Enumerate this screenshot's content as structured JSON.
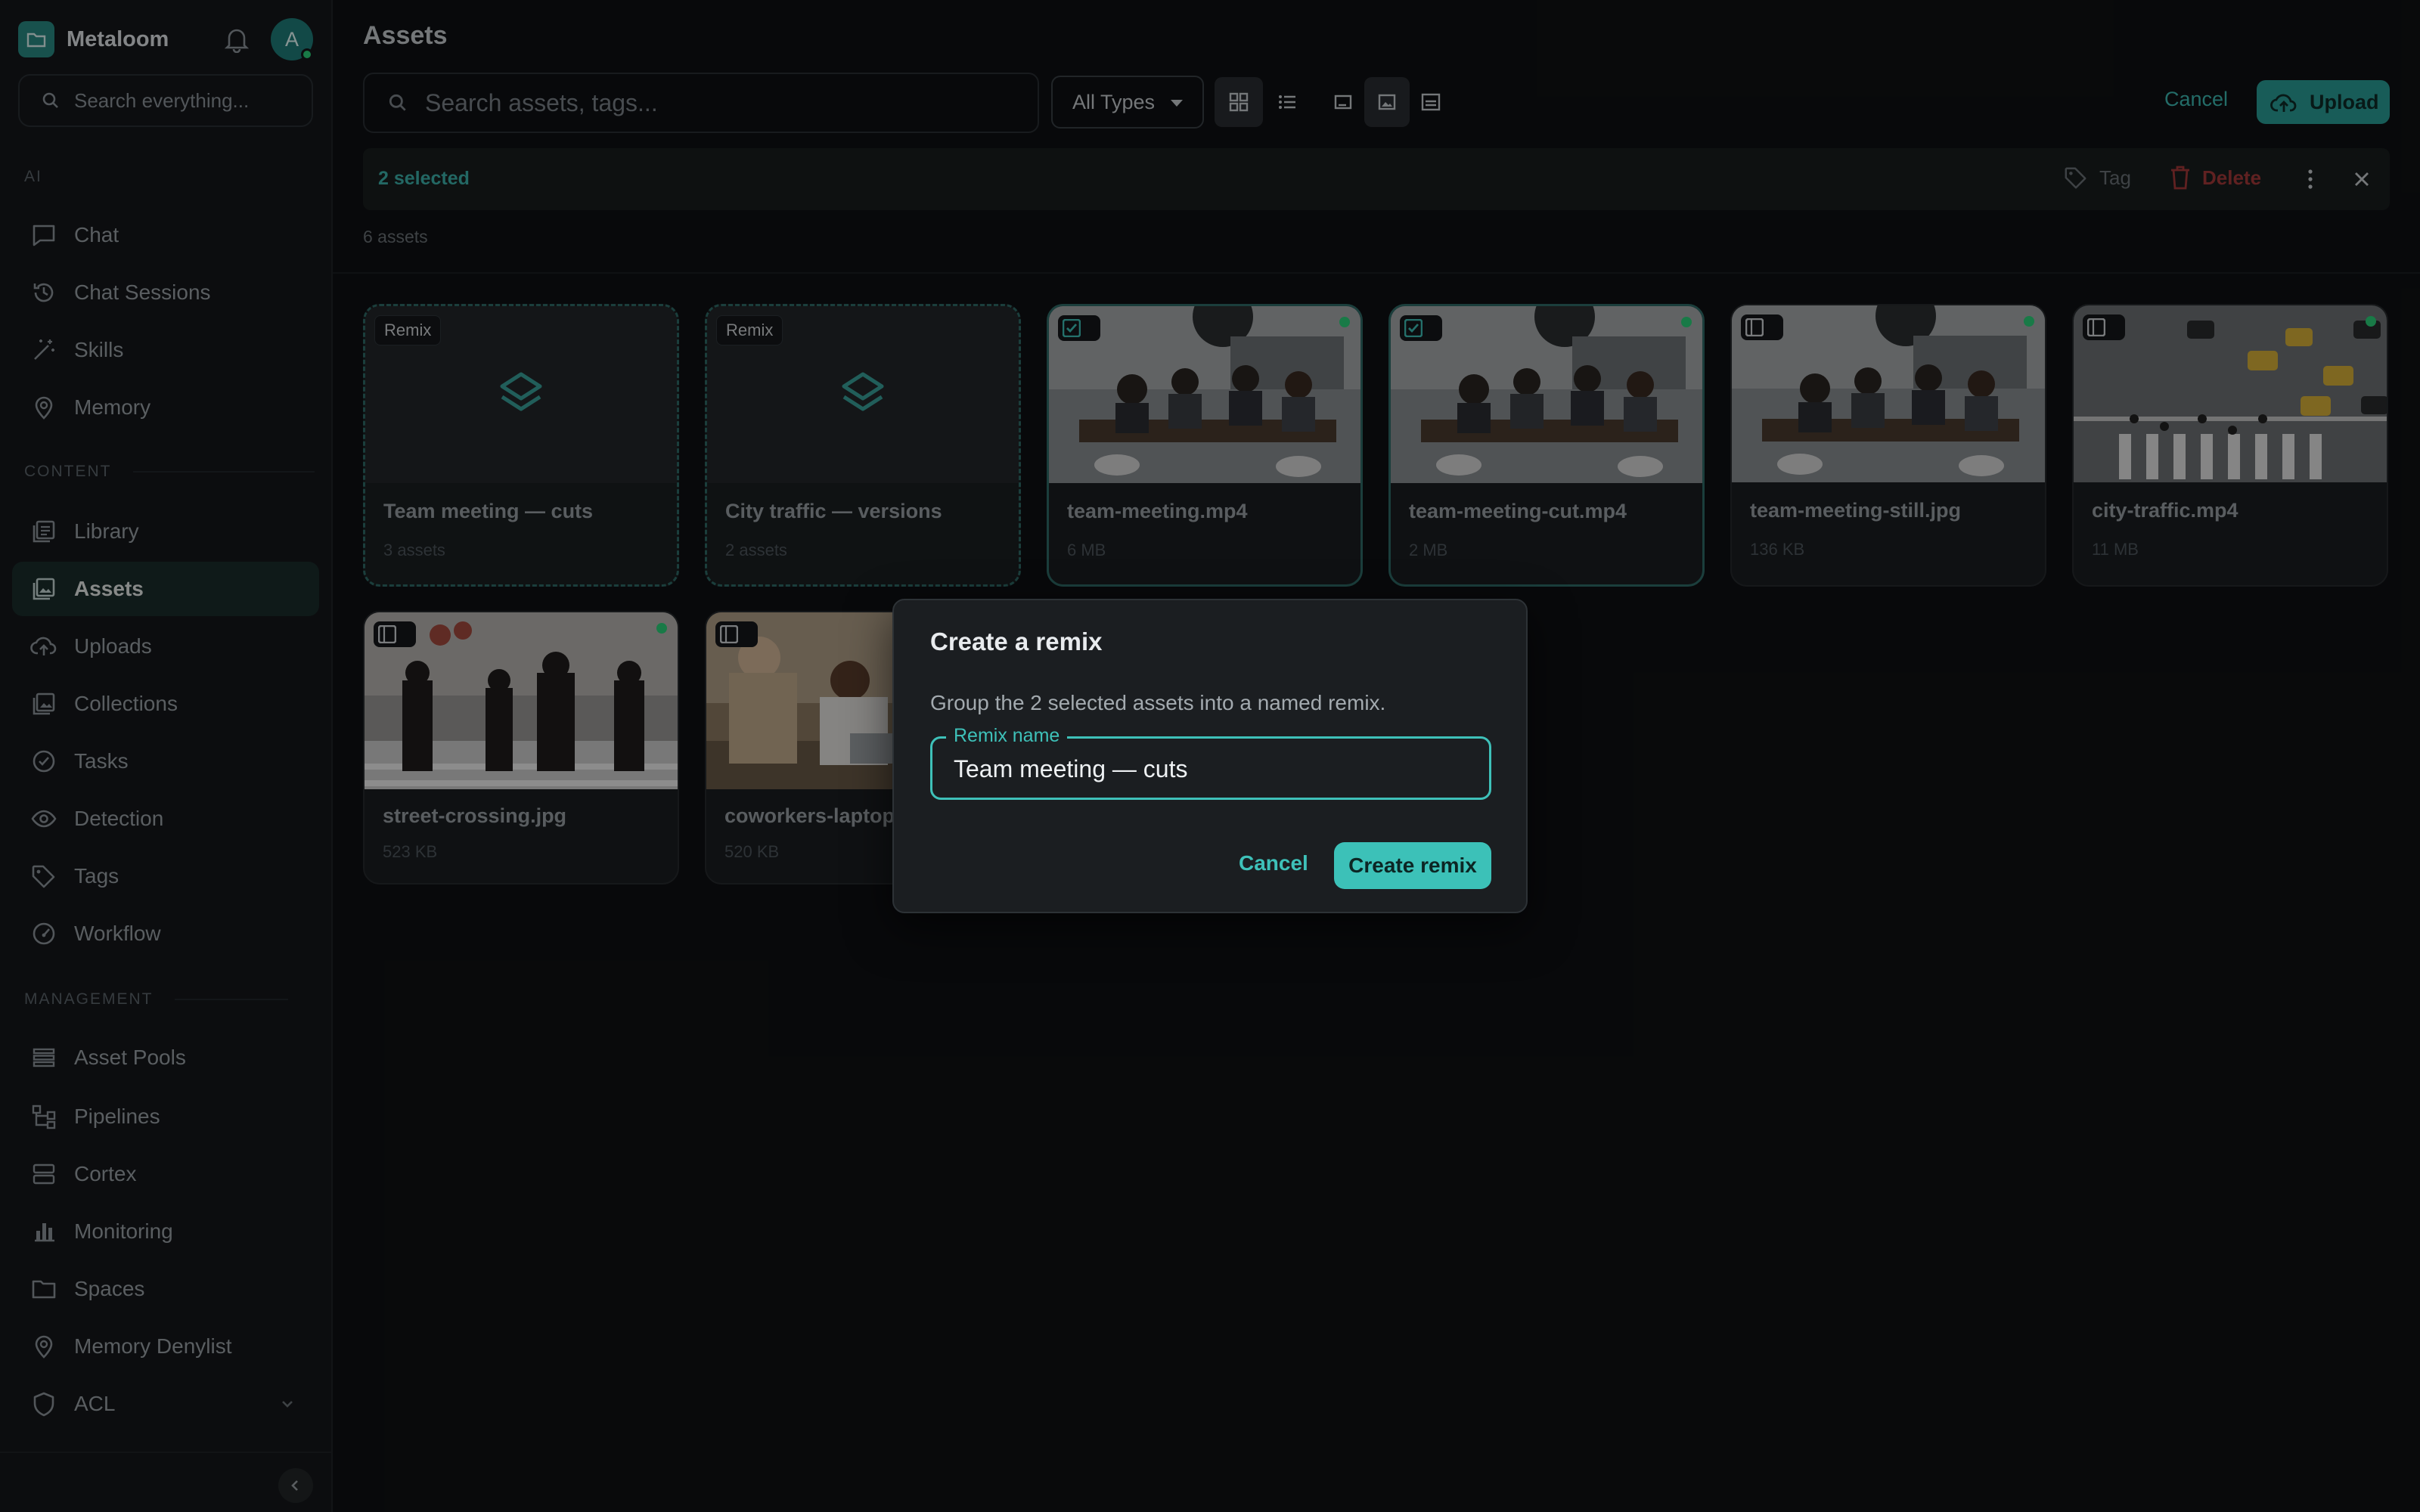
{
  "app": {
    "name": "Metaloom",
    "avatar_letter": "A",
    "search_placeholder": "Search everything..."
  },
  "sidebar": {
    "sections": {
      "ai": "AI",
      "content": "CONTENT",
      "management": "MANAGEMENT"
    },
    "items": [
      {
        "label": "Chat",
        "icon": "chat-icon"
      },
      {
        "label": "Chat Sessions",
        "icon": "history-icon"
      },
      {
        "label": "Skills",
        "icon": "magic-wand-icon"
      },
      {
        "label": "Memory",
        "icon": "memory-pin-icon"
      },
      {
        "label": "Library",
        "icon": "library-icon"
      },
      {
        "label": "Assets",
        "icon": "assets-icon",
        "active": true
      },
      {
        "label": "Uploads",
        "icon": "cloud-upload-icon"
      },
      {
        "label": "Collections",
        "icon": "collections-icon"
      },
      {
        "label": "Tasks",
        "icon": "check-circle-icon"
      },
      {
        "label": "Detection",
        "icon": "eye-icon"
      },
      {
        "label": "Tags",
        "icon": "tag-icon"
      },
      {
        "label": "Workflow",
        "icon": "gauge-icon"
      },
      {
        "label": "Asset Pools",
        "icon": "list-icon"
      },
      {
        "label": "Pipelines",
        "icon": "pipeline-icon"
      },
      {
        "label": "Cortex",
        "icon": "server-icon"
      },
      {
        "label": "Monitoring",
        "icon": "bar-chart-icon"
      },
      {
        "label": "Spaces",
        "icon": "folder-icon"
      },
      {
        "label": "Memory Denylist",
        "icon": "memory-pin-icon"
      },
      {
        "label": "ACL",
        "icon": "shield-icon"
      }
    ]
  },
  "main": {
    "title": "Assets",
    "search_placeholder": "Search assets, tags...",
    "type_filter": "All Types",
    "cancel": "Cancel",
    "upload": "Upload",
    "selection": {
      "count_label": "2 selected",
      "tag": "Tag",
      "delete": "Delete"
    },
    "asset_count": "6 assets",
    "remix_badge": "Remix",
    "cards": [
      {
        "title": "Team meeting — cuts",
        "sub": "3 assets",
        "kind": "remix"
      },
      {
        "title": "City traffic — versions",
        "sub": "2 assets",
        "kind": "remix"
      },
      {
        "title": "team-meeting.mp4",
        "sub": "6 MB",
        "kind": "meeting",
        "selected": true
      },
      {
        "title": "team-meeting-cut.mp4",
        "sub": "2 MB",
        "kind": "meeting",
        "selected": true
      },
      {
        "title": "team-meeting-still.jpg",
        "sub": "136 KB",
        "kind": "meeting"
      },
      {
        "title": "city-traffic.mp4",
        "sub": "11 MB",
        "kind": "traffic"
      },
      {
        "title": "street-crossing.jpg",
        "sub": "523 KB",
        "kind": "street"
      },
      {
        "title": "coworkers-laptop",
        "sub": "520 KB",
        "kind": "laptop"
      }
    ]
  },
  "dialog": {
    "title": "Create a remix",
    "description": "Group the 2 selected assets into a named remix.",
    "field_label": "Remix name",
    "field_value": "Team meeting — cuts",
    "cancel": "Cancel",
    "create": "Create remix"
  },
  "colors": {
    "accent": "#3ec1b9",
    "danger": "#a63a3a",
    "background": "#0f1113"
  }
}
